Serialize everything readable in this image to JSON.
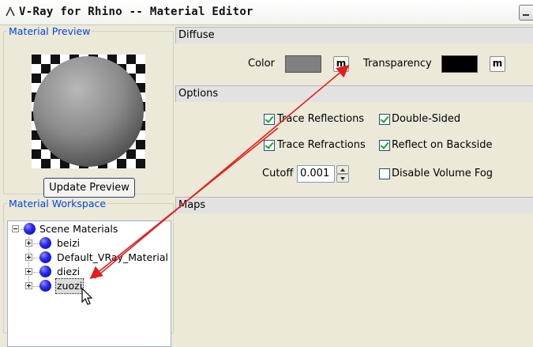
{
  "window": {
    "title": "V-Ray for Rhino -- Material Editor",
    "icon": "vray-icon"
  },
  "preview": {
    "legend": "Material Preview",
    "update_button": "Update Preview"
  },
  "workspace": {
    "legend": "Material Workspace",
    "root_label": "Scene Materials",
    "items": [
      {
        "label": "beizi"
      },
      {
        "label": "Default_VRay_Material"
      },
      {
        "label": "diezi"
      },
      {
        "label": "zuozi",
        "selected": true
      }
    ]
  },
  "diffuse": {
    "header": "Diffuse",
    "color_label": "Color",
    "color_value": "#808080",
    "transparency_label": "Transparency",
    "transparency_value": "#000000",
    "map_button": "m"
  },
  "options": {
    "header": "Options",
    "trace_reflections": {
      "label": "Trace Reflections",
      "checked": true
    },
    "double_sided": {
      "label": "Double-Sided",
      "checked": true
    },
    "trace_refractions": {
      "label": "Trace Refractions",
      "checked": true
    },
    "reflect_on_backside": {
      "label": "Reflect on Backside",
      "checked": true
    },
    "cutoff_label": "Cutoff",
    "cutoff_value": "0.001",
    "disable_volume_fog": {
      "label": "Disable Volume Fog",
      "checked": false
    }
  },
  "maps": {
    "header": "Maps"
  },
  "colors": {
    "accent_legend": "#0046d5",
    "annotation_arrow": "#e02020"
  }
}
